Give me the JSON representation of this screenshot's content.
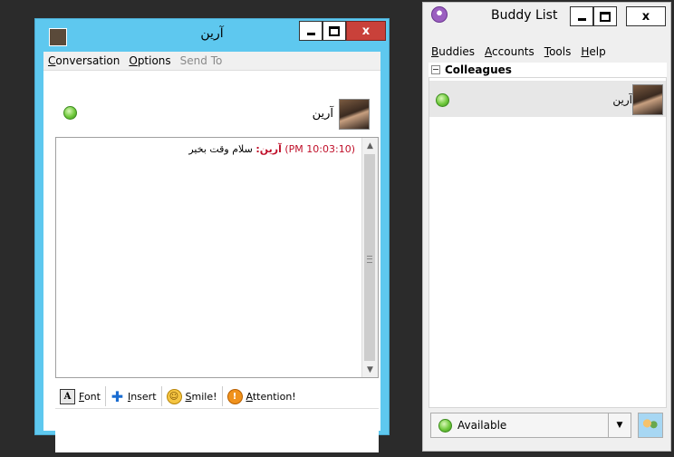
{
  "conversation_window": {
    "title": "آرین",
    "menu": [
      {
        "label": "Conversation",
        "accel": "C",
        "rest": "onversation",
        "disabled": false
      },
      {
        "label": "Options",
        "accel": "O",
        "rest": "ptions",
        "disabled": false
      },
      {
        "label": "Send To",
        "accel": "",
        "rest": "Send To",
        "disabled": true
      }
    ],
    "buddy_name": "آرین",
    "log": {
      "timestamp": "(10:03:10 PM)",
      "sender": "آرین:",
      "message": "سلام وقت بخیر"
    },
    "toolbar": {
      "font_accel": "F",
      "font_rest": "ont",
      "insert_accel": "I",
      "insert_rest": "nsert",
      "smile_accel": "S",
      "smile_rest": "mile!",
      "attention_accel": "A",
      "attention_rest": "ttention!"
    },
    "window_buttons": {
      "min": "minimize",
      "max": "maximize",
      "close": "x"
    }
  },
  "buddy_window": {
    "title": "Buddy List",
    "menu": [
      {
        "accel": "B",
        "rest": "uddies"
      },
      {
        "accel": "A",
        "rest": "ccounts"
      },
      {
        "accel": "T",
        "rest": "ools"
      },
      {
        "accel": "H",
        "rest": "elp"
      }
    ],
    "group": "Colleagues",
    "buddies": [
      {
        "name": "آرین",
        "status": "available"
      }
    ],
    "status": "Available",
    "window_buttons": {
      "close": "x"
    }
  },
  "colors": {
    "conv_frame": "#5ec8ef",
    "close_button": "#c9413a",
    "log_highlight": "#c0102a",
    "status_green": "#6fc93b"
  },
  "icons": [
    "window-icon",
    "status-available-icon",
    "font-icon",
    "insert-icon",
    "smile-icon",
    "attention-icon",
    "dropdown-arrow-icon",
    "people-icon"
  ]
}
